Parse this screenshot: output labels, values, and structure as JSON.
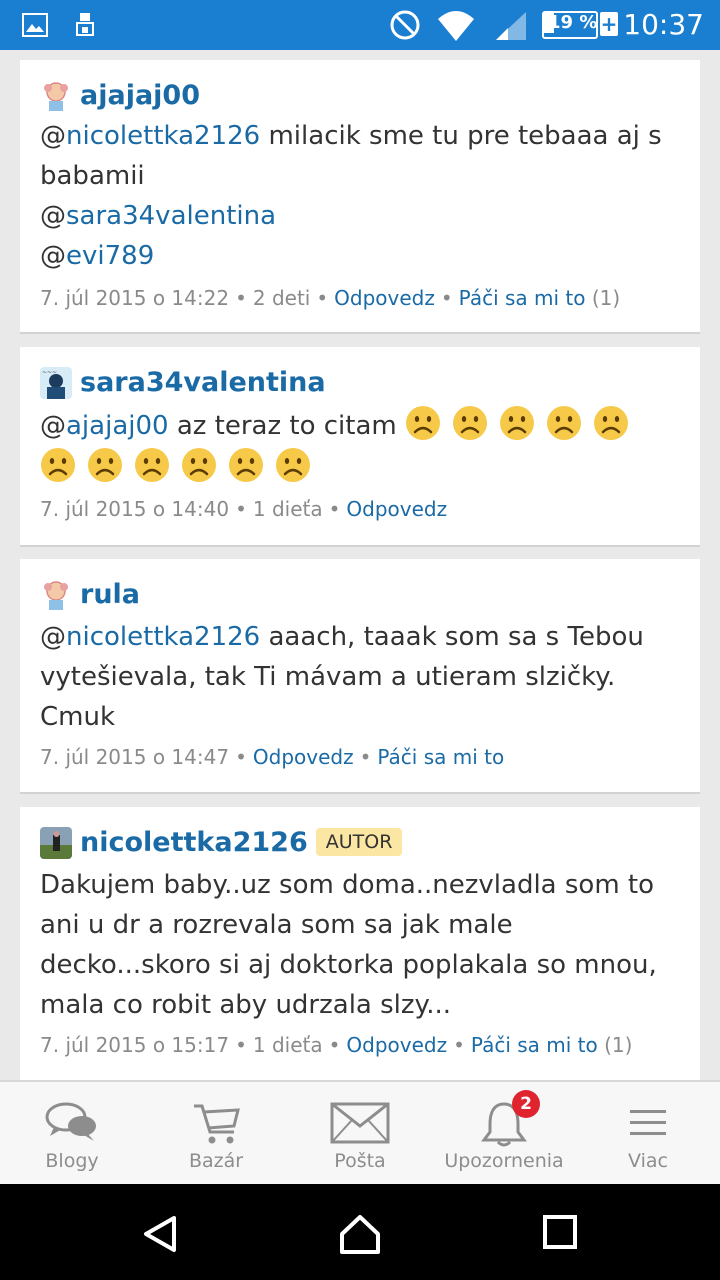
{
  "status_bar": {
    "time": "10:37",
    "battery": "19 %",
    "battery_plus": "+"
  },
  "posts": [
    {
      "username": "ajajaj00",
      "lines": [
        [
          {
            "t": "@",
            "m": false
          },
          {
            "t": "nicolettka2126",
            "m": true
          },
          {
            "t": " milacik sme tu pre tebaaa aj s",
            "m": false
          }
        ],
        [
          {
            "t": "babamii",
            "m": false
          }
        ],
        [
          {
            "t": "@",
            "m": false
          },
          {
            "t": "sara34valentina",
            "m": true
          }
        ],
        [
          {
            "t": "@",
            "m": false
          },
          {
            "t": "evi789",
            "m": true
          }
        ]
      ],
      "date": "7. júl 2015 o 14:22",
      "children": "2 deti",
      "reply": "Odpovedz",
      "like": "Páči sa mi to",
      "like_count": "(1)"
    },
    {
      "username": "sara34valentina",
      "mention_at": "@",
      "mention": "ajajaj00",
      "text": " az teraz to citam",
      "emoji_count": 11,
      "date": "7. júl 2015 o 14:40",
      "children": "1 dieťa",
      "reply": "Odpovedz"
    },
    {
      "username": "rula",
      "lines": [
        [
          {
            "t": "@",
            "m": false
          },
          {
            "t": "nicolettka2126",
            "m": true
          },
          {
            "t": " aaach, taaak som sa s Tebou",
            "m": false
          }
        ],
        [
          {
            "t": "vytešievala, tak Ti mávam a utieram slzičky.",
            "m": false
          }
        ],
        [
          {
            "t": "Cmuk",
            "m": false
          }
        ]
      ],
      "date": "7. júl 2015 o 14:47",
      "reply": "Odpovedz",
      "like": "Páči sa mi to"
    },
    {
      "username": "nicolettka2126",
      "badge": "AUTOR",
      "lines": [
        [
          {
            "t": "Dakujem baby..uz som doma..nezvladla som to",
            "m": false
          }
        ],
        [
          {
            "t": "ani u dr a rozrevala som sa jak male",
            "m": false
          }
        ],
        [
          {
            "t": "decko...skoro si aj doktorka poplakala so mnou,",
            "m": false
          }
        ],
        [
          {
            "t": "mala co robit aby udrzala slzy...",
            "m": false
          }
        ]
      ],
      "date": "7. júl 2015 o 15:17",
      "children": "1 dieťa",
      "reply": "Odpovedz",
      "like": "Páči sa mi to",
      "like_count": "(1)"
    }
  ],
  "bottom_nav": [
    {
      "label": "Blogy",
      "icon": "speech-bubbles-icon"
    },
    {
      "label": "Bazár",
      "icon": "shopping-cart-icon"
    },
    {
      "label": "Pošta",
      "icon": "envelope-icon"
    },
    {
      "label": "Upozornenia",
      "icon": "bell-icon",
      "badge": "2"
    },
    {
      "label": "Viac",
      "icon": "menu-icon"
    }
  ],
  "colors": {
    "status_bar": "#1b7fd1",
    "link": "#1a6aa6",
    "badge_bg": "#fce6a3",
    "notif": "#e0242f"
  }
}
